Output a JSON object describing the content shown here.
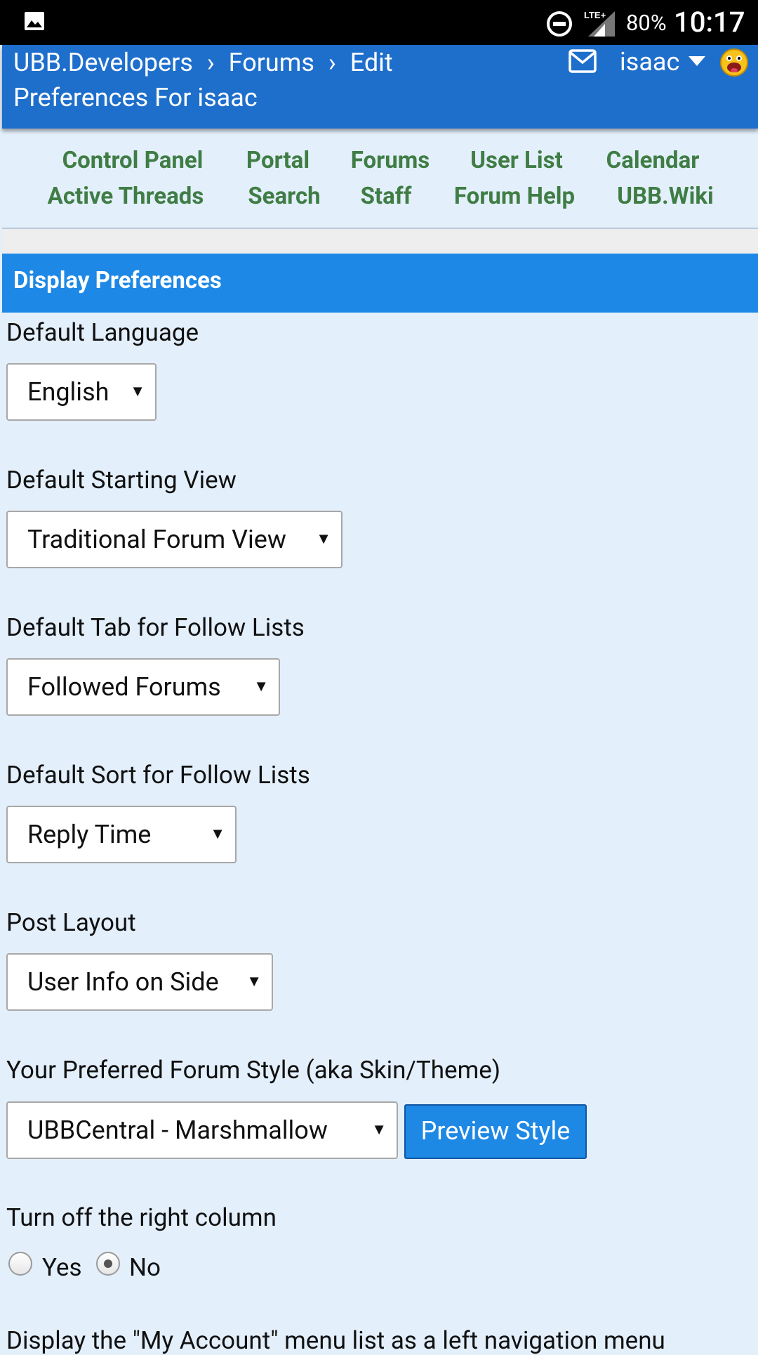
{
  "status_bar": {
    "battery": "80%",
    "time": "10:17",
    "icons": [
      "gallery-icon",
      "do-not-disturb-icon",
      "lte-signal-icon"
    ]
  },
  "header": {
    "breadcrumb": [
      "UBB.Developers",
      "Forums",
      "Edit Preferences For isaac"
    ],
    "separator": "›",
    "username": "isaac",
    "icons": [
      "mail-icon",
      "chevron-down-icon",
      "avatar-smiley-icon"
    ]
  },
  "nav": {
    "row1": [
      "Control Panel",
      "Portal",
      "Forums",
      "User List",
      "Calendar"
    ],
    "row2": [
      "Active Threads",
      "Search",
      "Staff",
      "Forum Help",
      "UBB.Wiki"
    ]
  },
  "section": {
    "title": "Display Preferences"
  },
  "fields": {
    "language": {
      "label": "Default Language",
      "value": "English"
    },
    "starting_view": {
      "label": "Default Starting View",
      "value": "Traditional Forum View"
    },
    "follow_tab": {
      "label": "Default Tab for Follow Lists",
      "value": "Followed Forums"
    },
    "follow_sort": {
      "label": "Default Sort for Follow Lists",
      "value": "Reply Time"
    },
    "post_layout": {
      "label": "Post Layout",
      "value": "User Info on Side"
    },
    "forum_style": {
      "label": "Your Preferred Forum Style (aka Skin/Theme)",
      "value": "UBBCentral - Marshmallow",
      "button": "Preview Style"
    },
    "right_column": {
      "label": "Turn off the right column",
      "options": [
        "Yes",
        "No"
      ],
      "selected": "No"
    },
    "my_account_menu": {
      "label": "Display the \"My Account\" menu list as a left navigation menu"
    }
  },
  "select_arrow": "▼"
}
